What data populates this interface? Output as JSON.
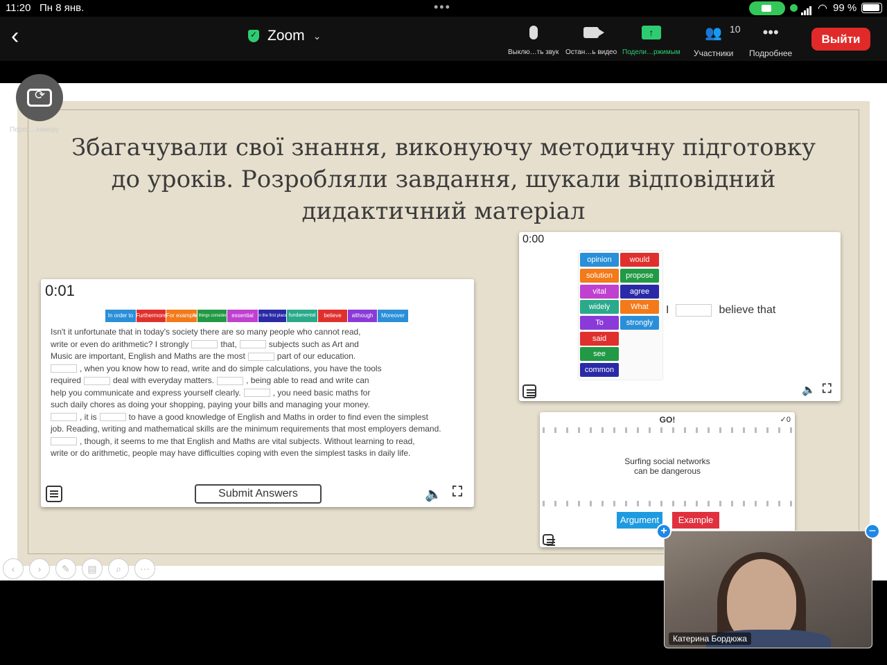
{
  "status": {
    "time": "11:20",
    "date": "Пн 8 янв.",
    "battery": "99 %"
  },
  "toolbar": {
    "app_title": "Zoom",
    "mute_label": "Выклю…ть звук",
    "stop_video_label": "Остан…ь видео",
    "share_label": "Подели…ржимым",
    "participants_label": "Участники",
    "participants_count": "10",
    "more_label": "Подробнее",
    "exit_label": "Выйти"
  },
  "camera_switch": {
    "label": "Перек…камеру"
  },
  "slide": {
    "title_lines": [
      "Збагачували свої знання, виконуючу методичну підготовку",
      "до уроків. Розробляли завдання, шукали відповідний",
      "дидактичний матеріал"
    ]
  },
  "exercise1": {
    "timer": "0:01",
    "words": [
      {
        "text": "In order to",
        "color": "#2a8fd8"
      },
      {
        "text": "Furthermore",
        "color": "#e0302e"
      },
      {
        "text": "For example",
        "color": "#f27a1a"
      },
      {
        "text": "All things considered",
        "color": "#229944"
      },
      {
        "text": "essential",
        "color": "#c040d0"
      },
      {
        "text": "In the first place",
        "color": "#2a2aa8"
      },
      {
        "text": "fundamental",
        "color": "#2aaa8a"
      },
      {
        "text": "believe",
        "color": "#e0302e"
      },
      {
        "text": "although",
        "color": "#8a3ad8"
      },
      {
        "text": "Moreover",
        "color": "#2a8fd8"
      }
    ],
    "passage": {
      "l1": "Isn't it unfortunate that in today's society there are so many people who cannot read,",
      "l2a": "write or even do arithmetic? I strongly",
      "l2b": "that,",
      "l2c": "subjects such as Art and",
      "l3a": "Music are important, English and Maths are the most",
      "l3b": "part of our education.",
      "l4": ", when you know how to read, write and do simple calculations, you have the tools",
      "l5a": "required",
      "l5b": "deal with everyday matters.",
      "l5c": ", being able to read and write can",
      "l6a": "help you communicate and express yourself clearly.",
      "l6b": ", you need basic maths for",
      "l7": "such daily chores as doing your shopping, paying your bills and managing your money.",
      "l8a": ", it is",
      "l8b": "to have a good knowledge of English and Maths in order to find even the simplest",
      "l9": "job. Reading, writing and mathematical skills are the minimum requirements that most employers demand.",
      "l10": ", though, it seems to me that English and Maths are vital subjects. Without learning to read,",
      "l11": "write or do arithmetic, people may have difficulties coping with even the simplest tasks in daily life."
    },
    "submit_label": "Submit Answers"
  },
  "exercise2": {
    "timer": "0:00",
    "grid": [
      {
        "text": "opinion",
        "color": "#2a8fd8"
      },
      {
        "text": "would",
        "color": "#e0302e"
      },
      {
        "text": "solution",
        "color": "#f27a1a"
      },
      {
        "text": "propose",
        "color": "#229944"
      },
      {
        "text": "vital",
        "color": "#c040d0"
      },
      {
        "text": "agree",
        "color": "#2a2aa8"
      },
      {
        "text": "widely",
        "color": "#2aaa8a"
      },
      {
        "text": "What",
        "color": "#f27a1a"
      },
      {
        "text": "To",
        "color": "#8a3ad8"
      },
      {
        "text": "strongly",
        "color": "#2a8fd8"
      },
      {
        "text": "said",
        "color": "#e0302e"
      },
      {
        "text": "see",
        "color": "#229944"
      },
      {
        "text": "common",
        "color": "#2a2aa8"
      }
    ],
    "sentence_start": "I",
    "sentence_end": "believe that"
  },
  "exercise3": {
    "go_label": "GO!",
    "score": "✓0",
    "statement_l1": "Surfing social networks",
    "statement_l2": "can be dangerous",
    "argument_label": "Argument",
    "argument_color": "#1e9be0",
    "example_label": "Example",
    "example_color": "#e0303e"
  },
  "self_view": {
    "name": "Катерина Бордюжа"
  }
}
